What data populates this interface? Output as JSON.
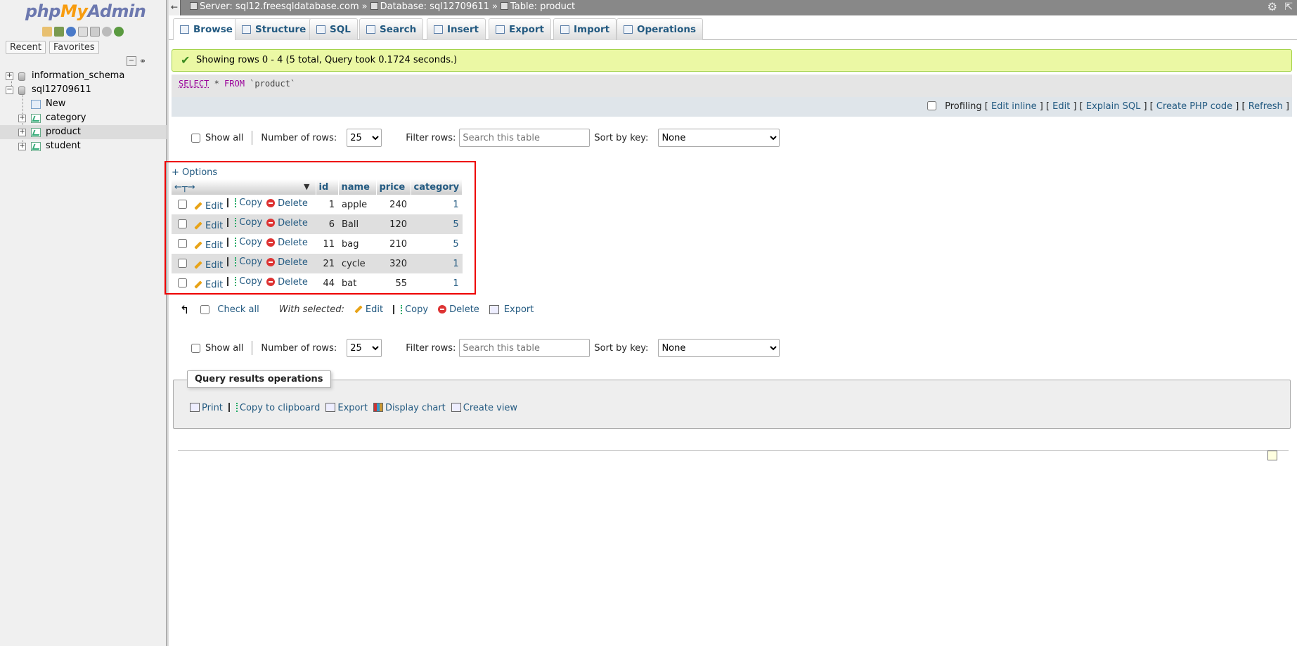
{
  "logo": {
    "php": "php",
    "my": "My",
    "admin": "Admin"
  },
  "nav": {
    "recent": "Recent",
    "favorites": "Favorites",
    "tree": [
      {
        "label": "information_schema"
      },
      {
        "label": "sql12709611"
      },
      {
        "label": "New"
      },
      {
        "label": "category"
      },
      {
        "label": "product"
      },
      {
        "label": "student"
      }
    ]
  },
  "breadcrumb": {
    "server": "Server: sql12.freesqldatabase.com",
    "database": "Database: sql12709611",
    "table": "Table: product",
    "sep": "»"
  },
  "tabs": [
    "Browse",
    "Structure",
    "SQL",
    "Search",
    "Insert",
    "Export",
    "Import",
    "Operations"
  ],
  "message": "Showing rows 0 - 4 (5 total, Query took 0.1724 seconds.)",
  "sql": {
    "select": "SELECT",
    "rest1": " * ",
    "from": "FROM",
    "rest2": " `product`"
  },
  "profbar": {
    "profiling": "Profiling",
    "edit_inline": "Edit inline",
    "edit": "Edit",
    "explain": "Explain SQL",
    "create_php": "Create PHP code",
    "refresh": "Refresh"
  },
  "navctrl": {
    "show_all": "Show all",
    "number_of_rows": "Number of rows:",
    "rows_value": "25",
    "filter_rows": "Filter rows:",
    "search_placeholder": "Search this table",
    "sort_by_key": "Sort by key:",
    "sort_value": "None"
  },
  "options": "+ Options",
  "table": {
    "columns": [
      "id",
      "name",
      "price",
      "category"
    ],
    "actions": {
      "edit": "Edit",
      "copy": "Copy",
      "delete": "Delete"
    },
    "rows": [
      {
        "id": "1",
        "name": "apple",
        "price": "240",
        "category": "1"
      },
      {
        "id": "6",
        "name": "Ball",
        "price": "120",
        "category": "5"
      },
      {
        "id": "11",
        "name": "bag",
        "price": "210",
        "category": "5"
      },
      {
        "id": "21",
        "name": "cycle",
        "price": "320",
        "category": "1"
      },
      {
        "id": "44",
        "name": "bat",
        "price": "55",
        "category": "1"
      }
    ]
  },
  "bulk": {
    "check_all": "Check all",
    "with_selected": "With selected:",
    "edit": "Edit",
    "copy": "Copy",
    "delete": "Delete",
    "export": "Export"
  },
  "qops": {
    "legend": "Query results operations",
    "print": "Print",
    "copy_clipboard": "Copy to clipboard",
    "export": "Export",
    "display_chart": "Display chart",
    "create_view": "Create view"
  }
}
